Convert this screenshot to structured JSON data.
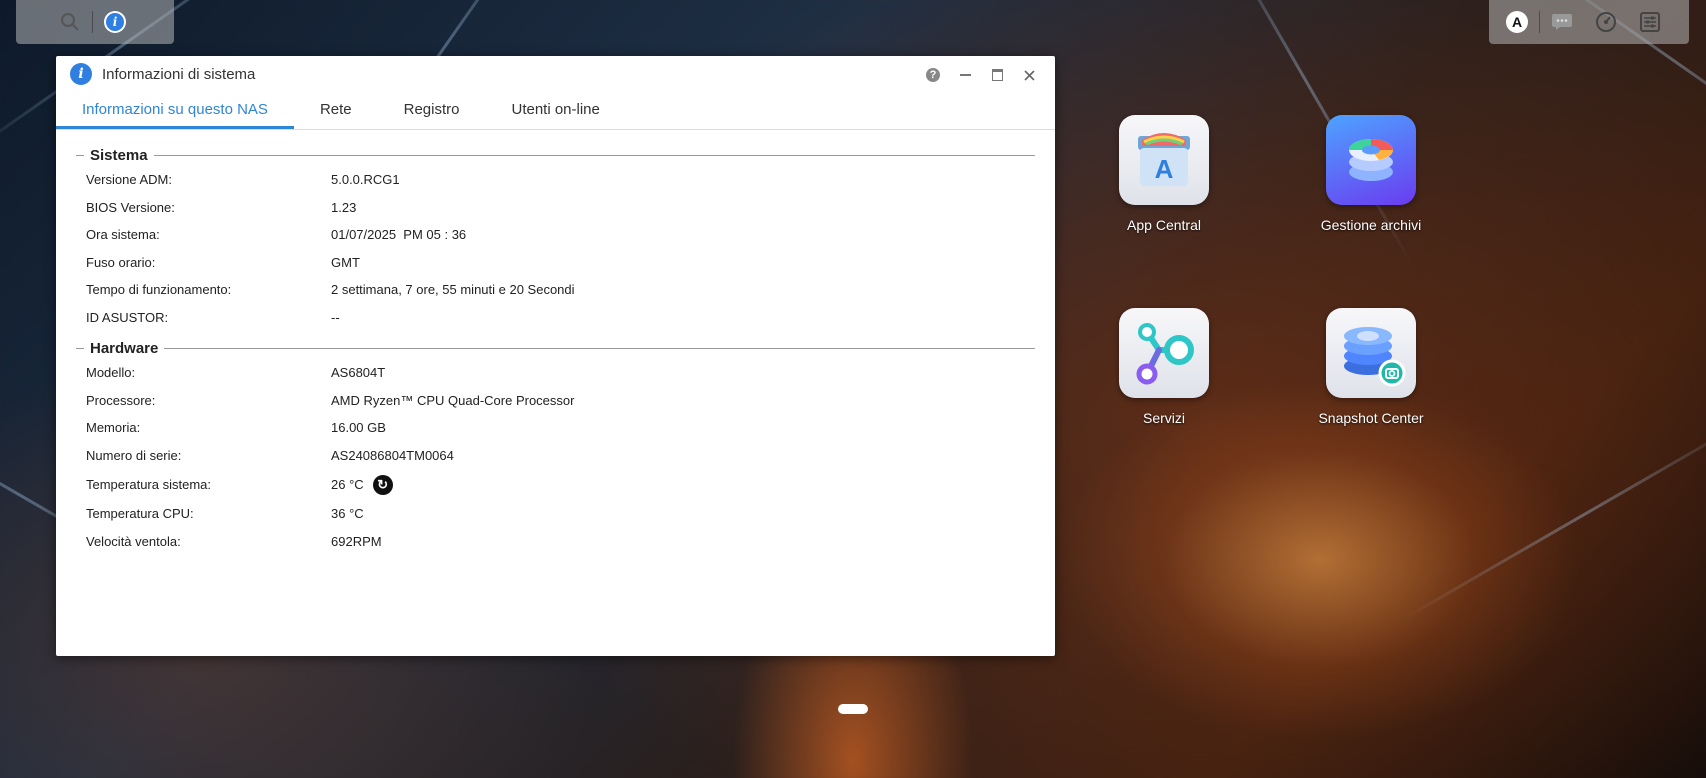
{
  "topbar": {
    "left": {
      "icons": [
        "search-icon",
        "info-icon"
      ]
    },
    "right": {
      "icons": [
        "user-icon",
        "message-icon",
        "dashboard-icon",
        "settings-icon"
      ],
      "user_initial": "A"
    }
  },
  "window": {
    "title": "Informazioni di sistema",
    "tabs": [
      {
        "label": "Informazioni su questo NAS",
        "active": true
      },
      {
        "label": "Rete"
      },
      {
        "label": "Registro"
      },
      {
        "label": "Utenti on-line"
      }
    ],
    "sections": {
      "system": {
        "title": "Sistema",
        "rows": [
          {
            "label": "Versione ADM:",
            "value": "5.0.0.RCG1"
          },
          {
            "label": "BIOS Versione:",
            "value": "1.23"
          },
          {
            "label": "Ora sistema:",
            "value": "01/07/2025  PM 05 : 36"
          },
          {
            "label": "Fuso orario:",
            "value": "GMT"
          },
          {
            "label": "Tempo di funzionamento:",
            "value": "2 settimana, 7 ore, 55 minuti e 20 Secondi"
          },
          {
            "label": "ID ASUSTOR:",
            "value": "--"
          }
        ]
      },
      "hardware": {
        "title": "Hardware",
        "rows": [
          {
            "label": "Modello:",
            "value": "AS6804T"
          },
          {
            "label": "Processore:",
            "value": "AMD Ryzen™ CPU Quad-Core Processor"
          },
          {
            "label": "Memoria:",
            "value": "16.00 GB"
          },
          {
            "label": "Numero di serie:",
            "value": "AS24086804TM0064"
          },
          {
            "label": "Temperatura sistema:",
            "value": "26 °C"
          },
          {
            "label": "Temperatura CPU:",
            "value": "36 °C"
          },
          {
            "label": "Velocità ventola:",
            "value": "692RPM"
          }
        ]
      }
    }
  },
  "desktop": {
    "apps": [
      {
        "label": "App Central",
        "icon": "app-central-icon"
      },
      {
        "label": "Gestione archivi",
        "icon": "storage-manager-icon"
      },
      {
        "label": "Servizi",
        "icon": "services-icon"
      },
      {
        "label": "Snapshot Center",
        "icon": "snapshot-center-icon"
      }
    ]
  },
  "colors": {
    "accent": "#2f86d8",
    "info_blue": "#2f7fe0"
  }
}
